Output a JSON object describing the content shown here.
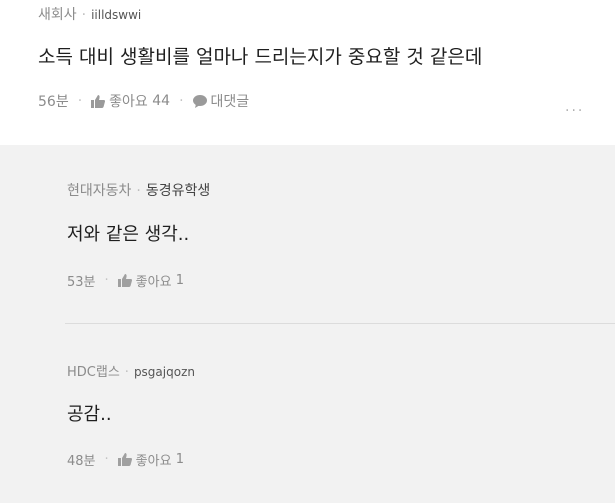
{
  "comment": {
    "company": "새회사",
    "author": "iilldswwi",
    "text": "소득 대비 생활비를 얼마나 드리는지가 중요할 것 같은데",
    "time": "56분",
    "like_label": "좋아요",
    "like_count": "44",
    "reply_label": "대댓글",
    "more_icon": "more-dots-icon"
  },
  "replies": [
    {
      "company": "현대자동차",
      "author": "동경유학생",
      "text": "저와 같은 생각..",
      "time": "53분",
      "like_label": "좋아요",
      "like_count": "1"
    },
    {
      "company": "HDC랩스",
      "author": "psgajqozn",
      "text": "공감..",
      "time": "48분",
      "like_label": "좋아요",
      "like_count": "1"
    }
  ],
  "colors": {
    "meta_gray": "#8c8c8c",
    "reply_bg": "#f2f2f2",
    "divider": "#dcdcdc"
  }
}
